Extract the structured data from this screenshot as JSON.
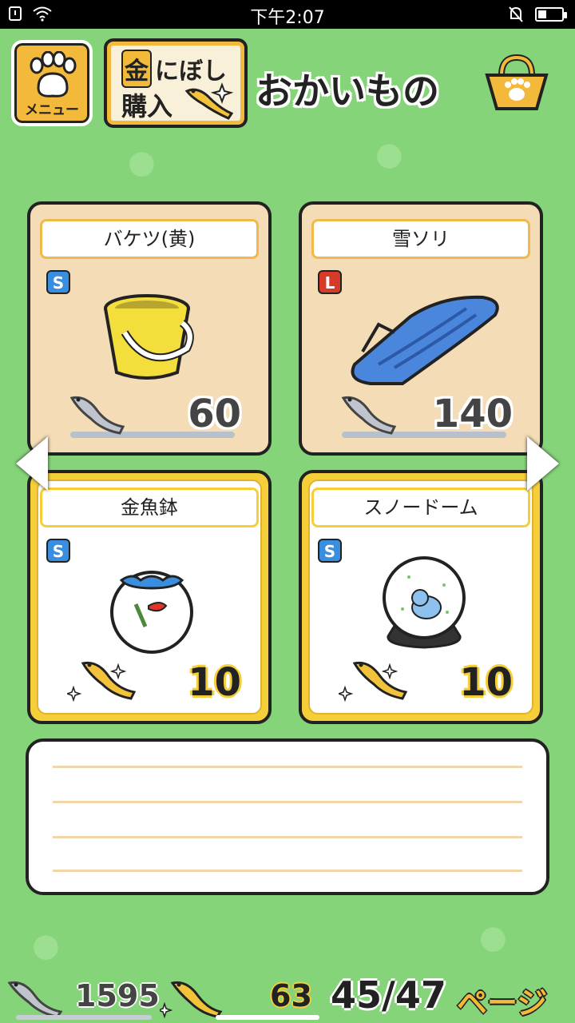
{
  "status_bar": {
    "time": "下午2:07"
  },
  "header": {
    "menu_label": "メニュー",
    "gold_button": {
      "line1_kin": "金",
      "line1_rest": "にぼし",
      "line2": "購入"
    },
    "title": "おかいもの"
  },
  "items": [
    {
      "name": "バケツ(黄)",
      "size": "S",
      "price": "60",
      "currency": "silver-niboshi",
      "style": "owned"
    },
    {
      "name": "雪ソリ",
      "size": "L",
      "price": "140",
      "currency": "silver-niboshi",
      "style": "owned"
    },
    {
      "name": "金魚鉢",
      "size": "S",
      "price": "10",
      "currency": "gold-niboshi",
      "style": "gold"
    },
    {
      "name": "スノードーム",
      "size": "S",
      "price": "10",
      "currency": "gold-niboshi",
      "style": "gold"
    }
  ],
  "footer": {
    "silver_count": "1595",
    "gold_count": "63",
    "page": "45/47",
    "page_label": "ページ"
  },
  "colors": {
    "background": "#86d47a",
    "accent": "#f2b93a",
    "size_s": "#3a8ee0",
    "size_l": "#d83a2a"
  }
}
